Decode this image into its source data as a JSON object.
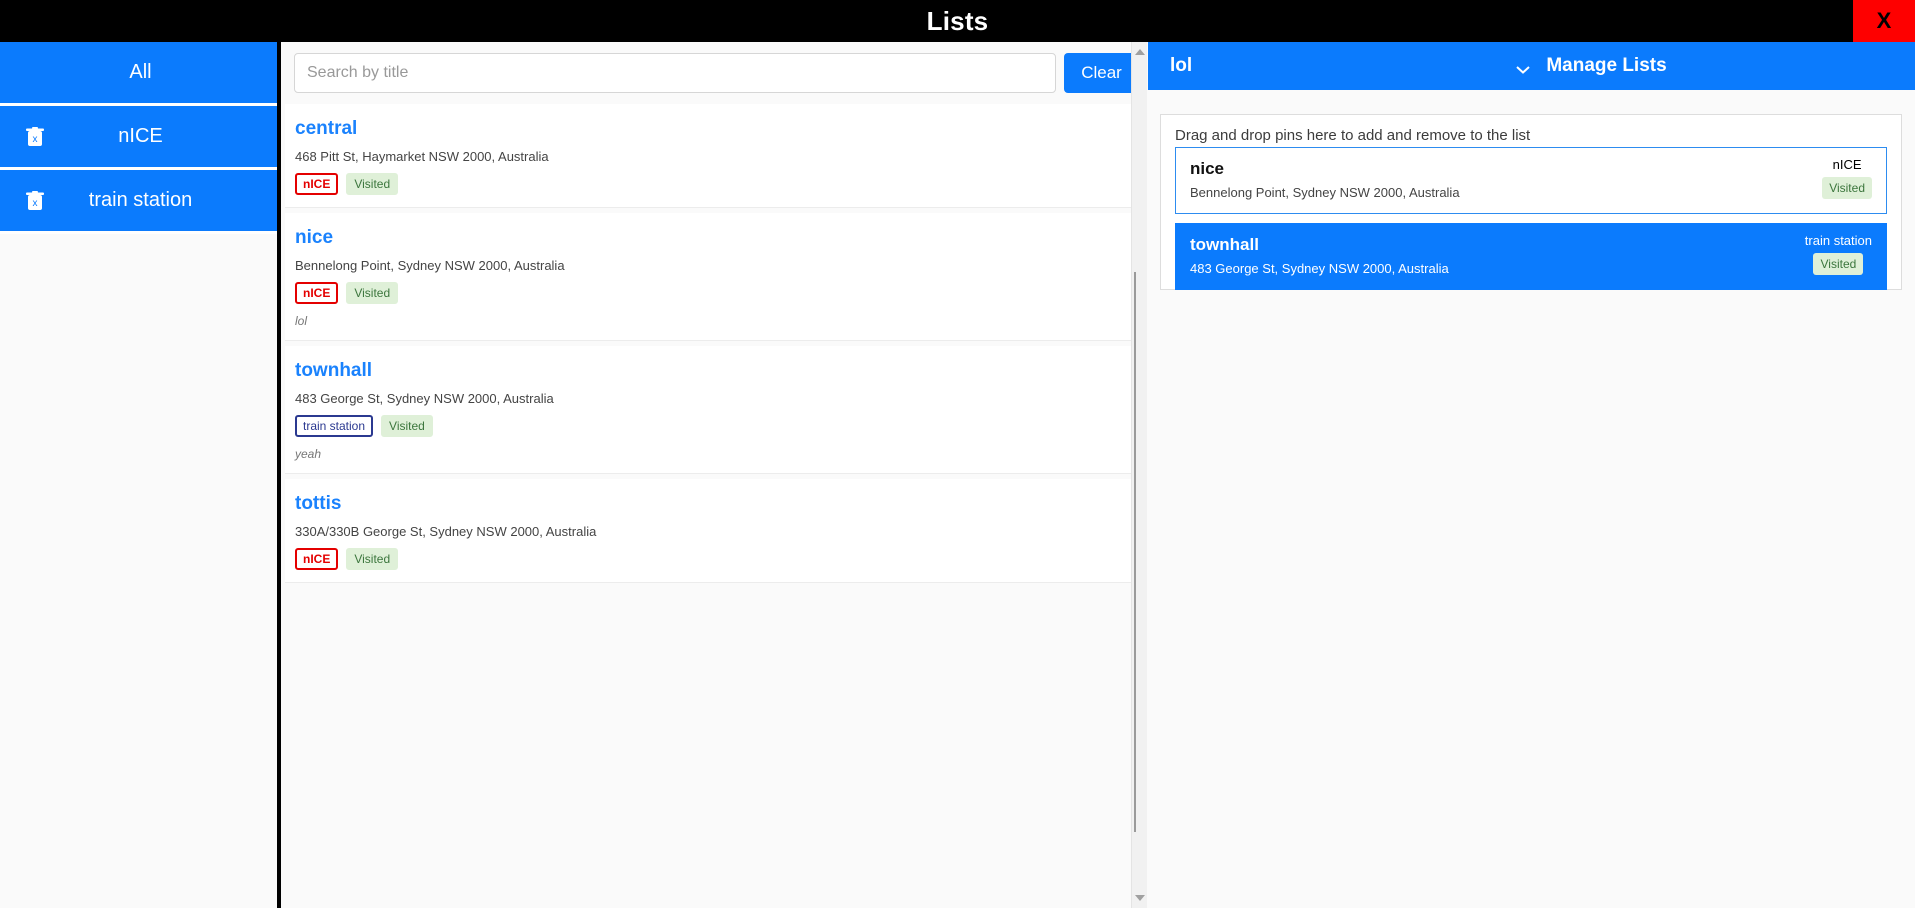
{
  "window": {
    "title": "Lists",
    "close_label": "X",
    "close_color": "#fe0000"
  },
  "theme": {
    "accent": "#0b7bfd",
    "link": "#1a82fd",
    "tag_red": "#e40000",
    "tag_navy": "#2b3990",
    "visited_bg": "#dff0d8",
    "visited_fg": "#3c763d"
  },
  "sidebar": {
    "items": [
      {
        "label": "All",
        "has_delete": false,
        "delete_icon": "trash-icon"
      },
      {
        "label": "nICE",
        "has_delete": true,
        "delete_icon": "trash-icon"
      },
      {
        "label": "train station",
        "has_delete": true,
        "delete_icon": "trash-icon"
      }
    ]
  },
  "search": {
    "value": "",
    "placeholder": "Search by title",
    "clear_label": "Clear"
  },
  "results": [
    {
      "title": "central",
      "address": "468 Pitt St, Haymarket NSW 2000, Australia",
      "category": "nICE",
      "category_style": "red",
      "visited": "Visited",
      "note": ""
    },
    {
      "title": "nice",
      "address": "Bennelong Point, Sydney NSW 2000, Australia",
      "category": "nICE",
      "category_style": "red",
      "visited": "Visited",
      "note": "lol"
    },
    {
      "title": "townhall",
      "address": "483 George St, Sydney NSW 2000, Australia",
      "category": "train station",
      "category_style": "navy",
      "visited": "Visited",
      "note": "yeah"
    },
    {
      "title": "tottis",
      "address": "330A/330B George St, Sydney NSW 2000, Australia",
      "category": "nICE",
      "category_style": "red",
      "visited": "Visited",
      "note": ""
    }
  ],
  "right_panel": {
    "selected_list": "lol",
    "dropdown_icon": "chevron-down-icon",
    "manage_label": "Manage Lists",
    "dropzone_hint": "Drag and drop pins here to add and remove to the list",
    "dropzone_items": [
      {
        "title": "nice",
        "address": "Bennelong Point, Sydney NSW 2000, Australia",
        "category": "nICE",
        "visited": "Visited",
        "selected": false
      },
      {
        "title": "townhall",
        "address": "483 George St, Sydney NSW 2000, Australia",
        "category": "train station",
        "visited": "Visited",
        "selected": true
      }
    ]
  },
  "scrollbar": {
    "up_icon": "scroll-up-arrow-icon",
    "down_icon": "scroll-down-arrow-icon"
  }
}
